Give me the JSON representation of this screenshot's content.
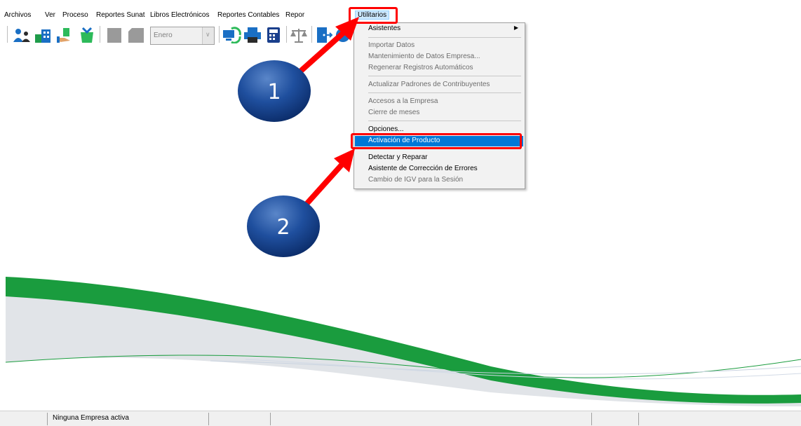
{
  "menu": {
    "items": [
      "Archivos",
      "Ver",
      "Proceso",
      "Reportes Sunat",
      "Libros Electrónicos",
      "Reportes Contables",
      "Repor",
      "Utilitarios"
    ]
  },
  "toolbar": {
    "month_combo": "Enero",
    "icons": [
      "users-icon",
      "building-icon",
      "hand-money-icon",
      "shopping-icon",
      "disabled-box-icon",
      "disabled-box-icon",
      "refresh-computer-icon",
      "printer-icon",
      "calculator-icon",
      "scale-icon",
      "exit-door-icon",
      "help-icon"
    ]
  },
  "dropdown": {
    "items": [
      {
        "label": "Asistentes",
        "disabled": false,
        "submenu": true
      },
      {
        "label": "Importar Datos",
        "disabled": true
      },
      {
        "label": "Mantenimiento de Datos Empresa...",
        "disabled": true
      },
      {
        "label": "Regenerar Registros Automáticos",
        "disabled": true
      },
      {
        "label": "Actualizar Padrones de Contribuyentes",
        "disabled": true
      },
      {
        "label": "Accesos a la Empresa",
        "disabled": true
      },
      {
        "label": "Cierre de meses",
        "disabled": true
      },
      {
        "label": "Opciones...",
        "disabled": false
      },
      {
        "label": "Activación de Producto",
        "disabled": false,
        "highlighted": true
      },
      {
        "label": "Detectar y Reparar",
        "disabled": false
      },
      {
        "label": "Asistente de Corrección de Errores",
        "disabled": false
      },
      {
        "label": "Cambio de IGV para la Sesión",
        "disabled": true
      }
    ]
  },
  "annotations": {
    "bubble_1": "1",
    "bubble_2": "2"
  },
  "statusbar": {
    "company": "Ninguna Empresa activa"
  },
  "colors": {
    "highlight": "#0078d7",
    "annotation_red": "#ff0000",
    "bubble_blue": "#0d3d8c",
    "wave_green": "#1a9c3e"
  }
}
